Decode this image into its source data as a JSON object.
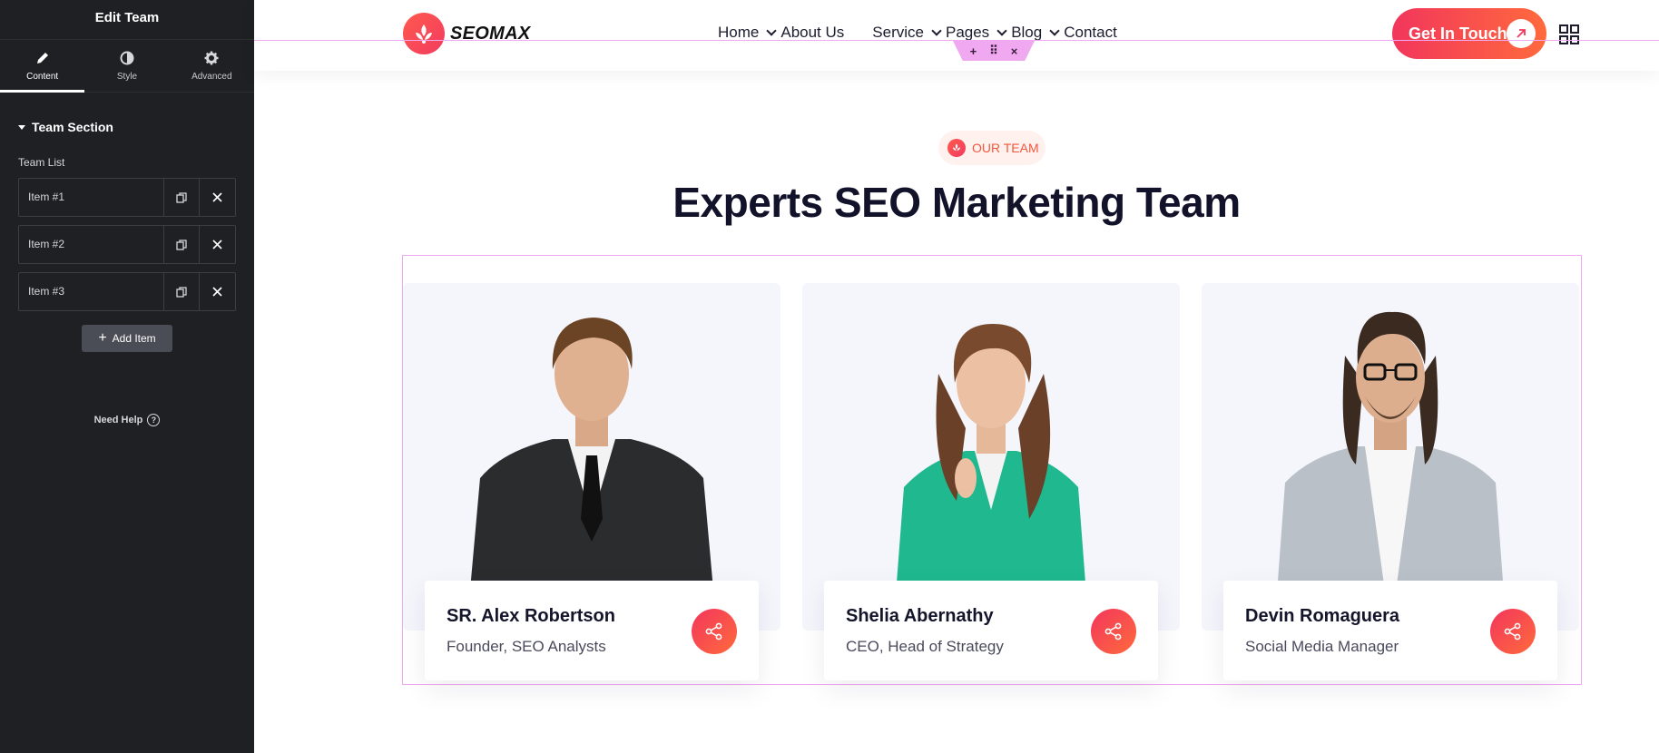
{
  "panel": {
    "title": "Edit Team",
    "tabs": [
      {
        "label": "Content",
        "icon": "pencil-icon"
      },
      {
        "label": "Style",
        "icon": "half-circle-icon"
      },
      {
        "label": "Advanced",
        "icon": "gear-icon"
      }
    ],
    "section_title": "Team Section",
    "list_label": "Team List",
    "items": [
      {
        "label": "Item #1"
      },
      {
        "label": "Item #2"
      },
      {
        "label": "Item #3"
      }
    ],
    "add_item_label": "Add Item",
    "need_help_label": "Need Help"
  },
  "header": {
    "logo_text": "SEOMAX",
    "nav": [
      {
        "label": "Home",
        "dropdown": true
      },
      {
        "label": "About Us",
        "dropdown": false
      },
      {
        "label": "Service",
        "dropdown": true
      },
      {
        "label": "Pages",
        "dropdown": true
      },
      {
        "label": "Blog",
        "dropdown": true
      },
      {
        "label": "Contact",
        "dropdown": false
      }
    ],
    "cta_label": "Get In Touch"
  },
  "section": {
    "badge": "OUR TEAM",
    "title": "Experts SEO Marketing Team"
  },
  "team": [
    {
      "name": "SR. Alex Robertson",
      "role": "Founder, SEO Analysts"
    },
    {
      "name": "Shelia Abernathy",
      "role": "CEO, Head of Strategy"
    },
    {
      "name": "Devin Romaguera",
      "role": "Social Media Manager"
    }
  ],
  "colors": {
    "accent_start": "#f2365c",
    "accent_end": "#ff6a3d",
    "panel_bg": "#1f2024",
    "selection_outline": "#f0a9f0"
  }
}
